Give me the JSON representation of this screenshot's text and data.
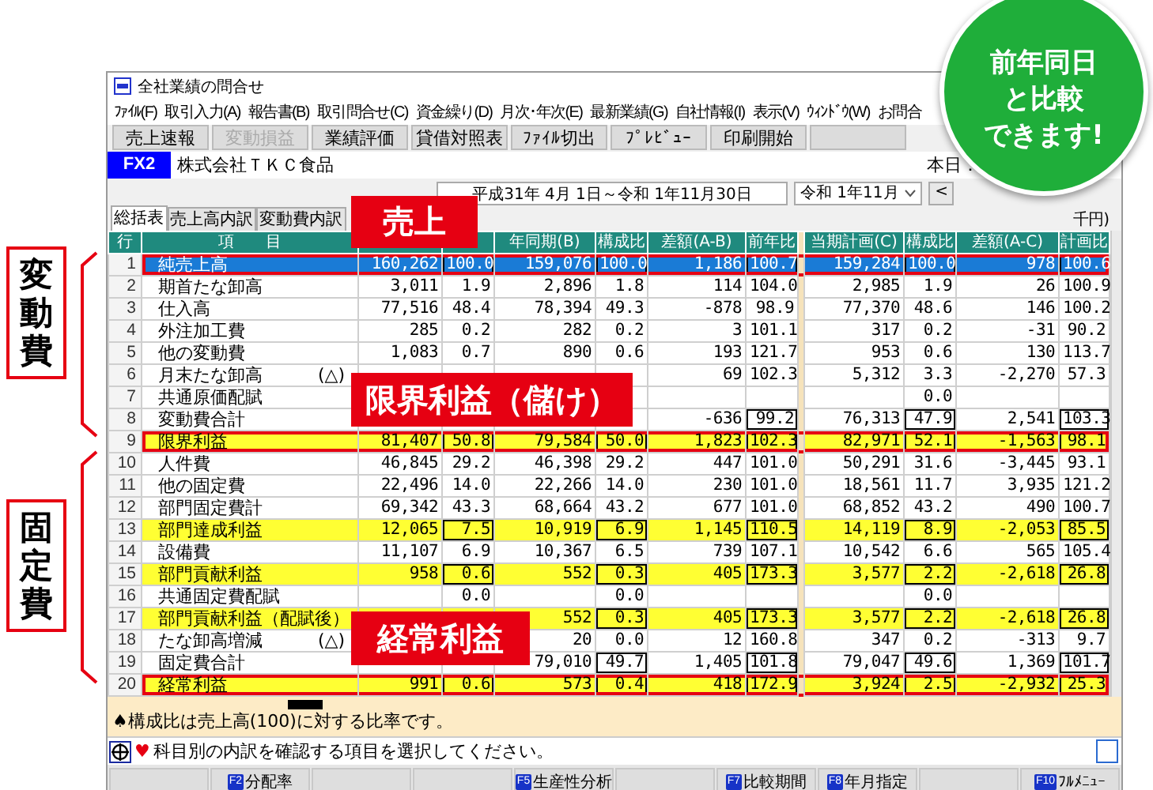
{
  "window": {
    "title": "全社業績の問合せ"
  },
  "menu": [
    "ﾌｧｲﾙ(F)",
    "取引入力(A)",
    "報告書(B)",
    "取引問合せ(C)",
    "資金繰り(D)",
    "月次･年次(E)",
    "最新業績(G)",
    "自社情報(I)",
    "表示(V)",
    "ｳｨﾝﾄﾞｳ(W)",
    "お問合"
  ],
  "toolbar": [
    {
      "kind": "button",
      "label": "売上速報",
      "disabled": false
    },
    {
      "kind": "button",
      "label": "変動損益",
      "disabled": true
    },
    {
      "kind": "button",
      "label": "業績評価",
      "disabled": false
    },
    {
      "kind": "button",
      "label": "貸借対照表",
      "disabled": false
    },
    {
      "kind": "button",
      "label": "ﾌｧｲﾙ切出",
      "disabled": false
    },
    {
      "kind": "button",
      "label": "ﾌﾟﾚﾋﾞｭｰ",
      "disabled": false
    },
    {
      "kind": "button",
      "label": "印刷開始",
      "disabled": false
    },
    {
      "kind": "empty"
    }
  ],
  "company": {
    "badge": "FX2",
    "name": "株式会社ＴＫＣ食品",
    "today_label": "本日："
  },
  "period": {
    "range": "平成31年 4月 1日～令和 1年11月30日",
    "month": "令和 1年11月",
    "prev_button": "<"
  },
  "unit": "千円)",
  "tabs": [
    {
      "label": "総括表",
      "selected": true
    },
    {
      "label": "売上高内訳",
      "selected": false
    },
    {
      "label": "変動費内訳",
      "selected": false
    }
  ],
  "table": {
    "row_header": "行",
    "item_header": "項　　目",
    "columns": [
      null,
      null,
      "年同期(B)",
      "構成比",
      "差額(A-B)",
      "前年比",
      "当期計画(C)",
      "構成比",
      "差額(A-C)",
      "計画比"
    ],
    "rows": [
      {
        "no": "1",
        "item": "純売上高",
        "selected": true,
        "highlighted": false,
        "boxed": true,
        "outlined": true,
        "cells": [
          "160,262",
          "100.0",
          "159,076",
          "100.0",
          "1,186",
          "100.7",
          "159,284",
          "100.0",
          "978",
          "100.6"
        ]
      },
      {
        "no": "2",
        "item": "期首たな卸高",
        "selected": false,
        "highlighted": false,
        "boxed": false,
        "outlined": false,
        "cells": [
          "3,011",
          "1.9",
          "2,896",
          "1.8",
          "114",
          "104.0",
          "2,985",
          "1.9",
          "26",
          "100.9"
        ]
      },
      {
        "no": "3",
        "item": "仕入高",
        "selected": false,
        "highlighted": false,
        "boxed": false,
        "outlined": false,
        "cells": [
          "77,516",
          "48.4",
          "78,394",
          "49.3",
          "-878",
          "98.9",
          "77,370",
          "48.6",
          "146",
          "100.2"
        ]
      },
      {
        "no": "4",
        "item": "外注加工費",
        "selected": false,
        "highlighted": false,
        "boxed": false,
        "outlined": false,
        "cells": [
          "285",
          "0.2",
          "282",
          "0.2",
          "3",
          "101.1",
          "317",
          "0.2",
          "-31",
          "90.2"
        ]
      },
      {
        "no": "5",
        "item": "他の変動費",
        "selected": false,
        "highlighted": false,
        "boxed": false,
        "outlined": false,
        "cells": [
          "1,083",
          "0.7",
          "890",
          "0.6",
          "193",
          "121.7",
          "953",
          "0.6",
          "130",
          "113.7"
        ]
      },
      {
        "no": "6",
        "item": "月末たな卸高",
        "note": "(△)",
        "selected": false,
        "highlighted": false,
        "boxed": false,
        "outlined": false,
        "cells": [
          null,
          null,
          null,
          null,
          "69",
          "102.3",
          "5,312",
          "3.3",
          "-2,270",
          "57.3"
        ]
      },
      {
        "no": "7",
        "item": "共通原価配賦",
        "selected": false,
        "highlighted": false,
        "boxed": false,
        "outlined": false,
        "cells": [
          null,
          null,
          null,
          null,
          null,
          null,
          null,
          "0.0",
          null,
          null
        ]
      },
      {
        "no": "8",
        "item": "変動費合計",
        "selected": false,
        "highlighted": false,
        "boxed": true,
        "outlined": false,
        "cells": [
          null,
          null,
          null,
          null,
          "-636",
          "99.2",
          "76,313",
          "47.9",
          "2,541",
          "103.3"
        ]
      },
      {
        "no": "9",
        "item": "限界利益",
        "selected": false,
        "highlighted": true,
        "boxed": true,
        "outlined": true,
        "cells": [
          "81,407",
          "50.8",
          "79,584",
          "50.0",
          "1,823",
          "102.3",
          "82,971",
          "52.1",
          "-1,563",
          "98.1"
        ]
      },
      {
        "no": "10",
        "item": "人件費",
        "selected": false,
        "highlighted": false,
        "boxed": false,
        "outlined": false,
        "cells": [
          "46,845",
          "29.2",
          "46,398",
          "29.2",
          "447",
          "101.0",
          "50,291",
          "31.6",
          "-3,445",
          "93.1"
        ]
      },
      {
        "no": "11",
        "item": "他の固定費",
        "selected": false,
        "highlighted": false,
        "boxed": false,
        "outlined": false,
        "cells": [
          "22,496",
          "14.0",
          "22,266",
          "14.0",
          "230",
          "101.0",
          "18,561",
          "11.7",
          "3,935",
          "121.2"
        ]
      },
      {
        "no": "12",
        "item": "部門固定費計",
        "selected": false,
        "highlighted": false,
        "boxed": false,
        "outlined": false,
        "cells": [
          "69,342",
          "43.3",
          "68,664",
          "43.2",
          "677",
          "101.0",
          "68,852",
          "43.2",
          "490",
          "100.7"
        ]
      },
      {
        "no": "13",
        "item": "部門達成利益",
        "selected": false,
        "highlighted": true,
        "boxed": true,
        "outlined": false,
        "cells": [
          "12,065",
          "7.5",
          "10,919",
          "6.9",
          "1,145",
          "110.5",
          "14,119",
          "8.9",
          "-2,053",
          "85.5"
        ]
      },
      {
        "no": "14",
        "item": "設備費",
        "selected": false,
        "highlighted": false,
        "boxed": false,
        "outlined": false,
        "cells": [
          "11,107",
          "6.9",
          "10,367",
          "6.5",
          "739",
          "107.1",
          "10,542",
          "6.6",
          "565",
          "105.4"
        ]
      },
      {
        "no": "15",
        "item": "部門貢献利益",
        "selected": false,
        "highlighted": true,
        "boxed": true,
        "outlined": false,
        "cells": [
          "958",
          "0.6",
          "552",
          "0.3",
          "405",
          "173.3",
          "3,577",
          "2.2",
          "-2,618",
          "26.8"
        ]
      },
      {
        "no": "16",
        "item": "共通固定費配賦",
        "selected": false,
        "highlighted": false,
        "boxed": false,
        "outlined": false,
        "cells": [
          null,
          "0.0",
          null,
          "0.0",
          null,
          null,
          null,
          "0.0",
          null,
          null
        ]
      },
      {
        "no": "17",
        "item": "部門貢献利益（配賦後）",
        "selected": false,
        "highlighted": true,
        "boxed": true,
        "outlined": false,
        "cells": [
          null,
          null,
          "552",
          "0.3",
          "405",
          "173.3",
          "3,577",
          "2.2",
          "-2,618",
          "26.8"
        ]
      },
      {
        "no": "18",
        "item": "たな卸高増減",
        "note": "(△)",
        "selected": false,
        "highlighted": false,
        "boxed": false,
        "outlined": false,
        "cells": [
          null,
          null,
          "20",
          "0.0",
          "12",
          "160.8",
          "347",
          "0.2",
          "-313",
          "9.7"
        ]
      },
      {
        "no": "19",
        "item": "固定費合計",
        "selected": false,
        "highlighted": false,
        "boxed": true,
        "outlined": false,
        "cells": [
          null,
          null,
          "79,010",
          "49.7",
          "1,405",
          "101.8",
          "79,047",
          "49.6",
          "1,369",
          "101.7"
        ]
      },
      {
        "no": "20",
        "item": "経常利益",
        "selected": false,
        "highlighted": true,
        "boxed": true,
        "outlined": true,
        "cells": [
          "991",
          "0.6",
          "573",
          "0.4",
          "418",
          "172.9",
          "3,924",
          "2.5",
          "-2,932",
          "25.3"
        ]
      }
    ]
  },
  "note": {
    "symbol": "♠",
    "text": "構成比は売上高(100)に対する比率です。"
  },
  "message": {
    "symbol": "♥",
    "text": "科目別の内訳を確認する項目を選択してください。"
  },
  "function_keys": [
    {
      "kind": "empty"
    },
    {
      "kind": "key",
      "key": "F2",
      "label": "分配率"
    },
    {
      "kind": "empty"
    },
    {
      "kind": "empty"
    },
    {
      "kind": "key",
      "key": "F5",
      "label": "生産性分析"
    },
    {
      "kind": "empty"
    },
    {
      "kind": "key",
      "key": "F7",
      "label": "比較期間"
    },
    {
      "kind": "key",
      "key": "F8",
      "label": "年月指定"
    },
    {
      "kind": "empty"
    },
    {
      "kind": "key",
      "key": "F10",
      "label": "ﾌﾙﾒﾆｭｰ"
    }
  ],
  "callouts": [
    "売上",
    "限界利益（儲け）",
    "経常利益"
  ],
  "side_labels": [
    "変動費",
    "固定費"
  ],
  "promo_badge": [
    "前年同日",
    "と比較",
    "できます!"
  ]
}
